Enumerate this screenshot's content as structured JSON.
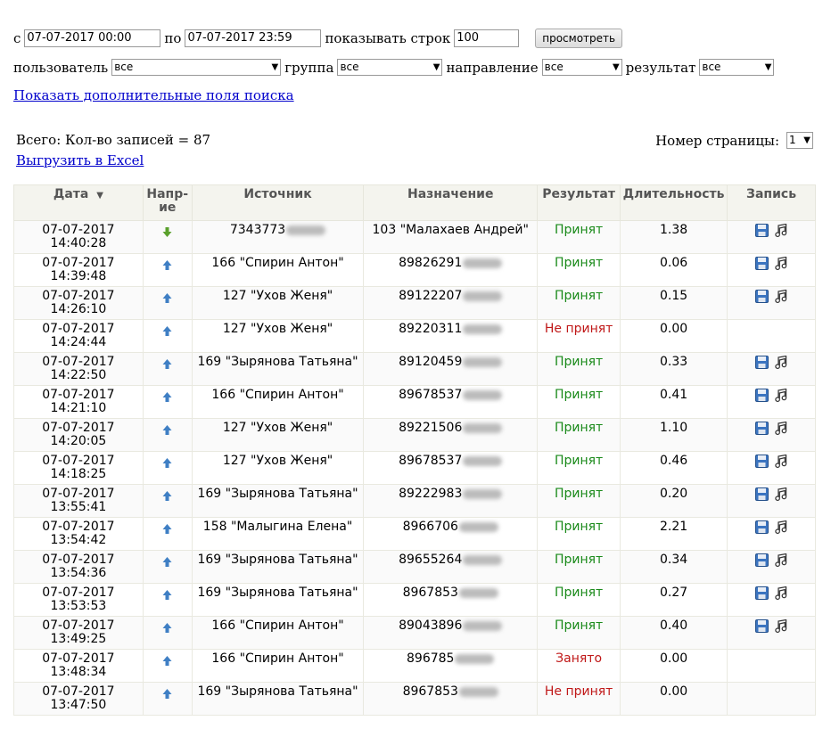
{
  "filters": {
    "from_label": "с",
    "from_value": "07-07-2017 00:00",
    "to_label": "по",
    "to_value": "07-07-2017 23:59",
    "rows_label": "показывать строк",
    "rows_value": "100",
    "view_button": "просмотреть",
    "user_label": "пользователь",
    "user_value": "все",
    "group_label": "группа",
    "group_value": "все",
    "direction_label": "направление",
    "direction_value": "все",
    "result_label": "результат",
    "result_value": "все"
  },
  "advanced_link": "Показать дополнительные поля поиска",
  "total_text": "Всего: Кол-во записей = 87",
  "excel_link": "Выгрузить в Excel",
  "page_label": "Номер страницы:",
  "page_value": "1",
  "table": {
    "headers": {
      "date": "Дата",
      "sort_indicator": "▼",
      "direction": "Напр-ие",
      "source": "Источник",
      "destination": "Назначение",
      "result": "Результат",
      "duration": "Длительность",
      "record": "Запись"
    },
    "rows": [
      {
        "date": "07-07-2017",
        "time": "14:40:28",
        "dir": "in",
        "source": "7343773",
        "destination": "103 \"Малахаев Андрей\"",
        "result": "Принят",
        "status": "ok",
        "duration": "1.38",
        "record": true
      },
      {
        "date": "07-07-2017",
        "time": "14:39:48",
        "dir": "out",
        "source": "166 \"Спирин Антон\"",
        "destination": "89826291",
        "result": "Принят",
        "status": "ok",
        "duration": "0.06",
        "record": true
      },
      {
        "date": "07-07-2017",
        "time": "14:26:10",
        "dir": "out",
        "source": "127 \"Ухов Женя\"",
        "destination": "89122207",
        "result": "Принят",
        "status": "ok",
        "duration": "0.15",
        "record": true
      },
      {
        "date": "07-07-2017",
        "time": "14:24:44",
        "dir": "out",
        "source": "127 \"Ухов Женя\"",
        "destination": "89220311",
        "result": "Не принят",
        "status": "bad",
        "duration": "0.00",
        "record": false
      },
      {
        "date": "07-07-2017",
        "time": "14:22:50",
        "dir": "out",
        "source": "169 \"Зырянова Татьяна\"",
        "destination": "89120459",
        "result": "Принят",
        "status": "ok",
        "duration": "0.33",
        "record": true
      },
      {
        "date": "07-07-2017",
        "time": "14:21:10",
        "dir": "out",
        "source": "166 \"Спирин Антон\"",
        "destination": "89678537",
        "result": "Принят",
        "status": "ok",
        "duration": "0.41",
        "record": true
      },
      {
        "date": "07-07-2017",
        "time": "14:20:05",
        "dir": "out",
        "source": "127 \"Ухов Женя\"",
        "destination": "89221506",
        "result": "Принят",
        "status": "ok",
        "duration": "1.10",
        "record": true
      },
      {
        "date": "07-07-2017",
        "time": "14:18:25",
        "dir": "out",
        "source": "127 \"Ухов Женя\"",
        "destination": "89678537",
        "result": "Принят",
        "status": "ok",
        "duration": "0.46",
        "record": true
      },
      {
        "date": "07-07-2017",
        "time": "13:55:41",
        "dir": "out",
        "source": "169 \"Зырянова Татьяна\"",
        "destination": "89222983",
        "result": "Принят",
        "status": "ok",
        "duration": "0.20",
        "record": true
      },
      {
        "date": "07-07-2017",
        "time": "13:54:42",
        "dir": "out",
        "source": "158 \"Малыгина Елена\"",
        "destination": "8966706",
        "result": "Принят",
        "status": "ok",
        "duration": "2.21",
        "record": true
      },
      {
        "date": "07-07-2017",
        "time": "13:54:36",
        "dir": "out",
        "source": "169 \"Зырянова Татьяна\"",
        "destination": "89655264",
        "result": "Принят",
        "status": "ok",
        "duration": "0.34",
        "record": true
      },
      {
        "date": "07-07-2017",
        "time": "13:53:53",
        "dir": "out",
        "source": "169 \"Зырянова Татьяна\"",
        "destination": "8967853",
        "result": "Принят",
        "status": "ok",
        "duration": "0.27",
        "record": true
      },
      {
        "date": "07-07-2017",
        "time": "13:49:25",
        "dir": "out",
        "source": "166 \"Спирин Антон\"",
        "destination": "89043896",
        "result": "Принят",
        "status": "ok",
        "duration": "0.40",
        "record": true
      },
      {
        "date": "07-07-2017",
        "time": "13:48:34",
        "dir": "out",
        "source": "166 \"Спирин Антон\"",
        "destination": "896785",
        "result": "Занято",
        "status": "bad",
        "duration": "0.00",
        "record": false
      },
      {
        "date": "07-07-2017",
        "time": "13:47:50",
        "dir": "out",
        "source": "169 \"Зырянова Татьяна\"",
        "destination": "8967853",
        "result": "Не принят",
        "status": "bad",
        "duration": "0.00",
        "record": false
      }
    ]
  },
  "colors": {
    "accepted": "#1a8a1a",
    "rejected": "#c01818",
    "link": "#0000cc",
    "header_bg": "#f4f4ee",
    "arrow_in": "#5aa02c",
    "arrow_out": "#3f7fc4"
  },
  "icons": {
    "incoming": "arrow-down-green-icon",
    "outgoing": "arrow-up-blue-icon",
    "save": "floppy-disk-icon",
    "play": "music-note-icon"
  }
}
